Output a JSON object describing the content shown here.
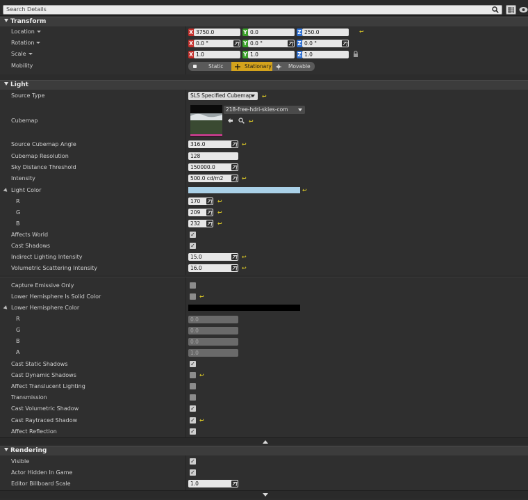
{
  "search": {
    "placeholder": "Search Details"
  },
  "transform": {
    "header": "Transform",
    "location": {
      "label": "Location",
      "x": "3750.0",
      "y": "0.0",
      "z": "250.0"
    },
    "rotation": {
      "label": "Rotation",
      "x": "0.0 °",
      "y": "0.0 °",
      "z": "0.0 °"
    },
    "scale": {
      "label": "Scale",
      "x": "1.0",
      "y": "1.0",
      "z": "1.0"
    },
    "axes": {
      "x": "X",
      "y": "Y",
      "z": "Z"
    },
    "mobility": {
      "label": "Mobility",
      "options": [
        "Static",
        "Stationary",
        "Movable"
      ],
      "selected": "Stationary"
    }
  },
  "light": {
    "header": "Light",
    "source_type": {
      "label": "Source Type",
      "value": "SLS Specified Cubemap"
    },
    "cubemap": {
      "label": "Cubemap",
      "asset": "218-free-hdri-skies-com"
    },
    "source_cubemap_angle": {
      "label": "Source Cubemap Angle",
      "value": "316.0"
    },
    "cubemap_resolution": {
      "label": "Cubemap Resolution",
      "value": "128"
    },
    "sky_distance_threshold": {
      "label": "Sky Distance Threshold",
      "value": "150000.0"
    },
    "intensity": {
      "label": "Intensity",
      "value": "500.0 cd/m2"
    },
    "light_color": {
      "label": "Light Color",
      "swatch": "#aad1e8",
      "r_label": "R",
      "g_label": "G",
      "b_label": "B",
      "r": "170",
      "g": "209",
      "b": "232"
    },
    "affects_world": {
      "label": "Affects World"
    },
    "cast_shadows": {
      "label": "Cast Shadows"
    },
    "indirect_lighting_intensity": {
      "label": "Indirect Lighting Intensity",
      "value": "15.0"
    },
    "volumetric_scattering_intensity": {
      "label": "Volumetric Scattering Intensity",
      "value": "16.0"
    },
    "capture_emissive_only": {
      "label": "Capture Emissive Only"
    },
    "lower_hemisphere_is_solid_color": {
      "label": "Lower Hemisphere Is Solid Color"
    },
    "lower_hemisphere_color": {
      "label": "Lower Hemisphere Color",
      "swatch": "#000000",
      "r_label": "R",
      "g_label": "G",
      "b_label": "B",
      "a_label": "A",
      "r": "0.0",
      "g": "0.0",
      "b": "0.0",
      "a": "1.0"
    },
    "cast_static_shadows": {
      "label": "Cast Static Shadows"
    },
    "cast_dynamic_shadows": {
      "label": "Cast Dynamic Shadows"
    },
    "affect_translucent_lighting": {
      "label": "Affect Translucent Lighting"
    },
    "transmission": {
      "label": "Transmission"
    },
    "cast_volumetric_shadow": {
      "label": "Cast Volumetric Shadow"
    },
    "cast_raytraced_shadow": {
      "label": "Cast Raytraced Shadow"
    },
    "affect_reflection": {
      "label": "Affect Reflection"
    }
  },
  "rendering": {
    "header": "Rendering",
    "visible": {
      "label": "Visible"
    },
    "actor_hidden_in_game": {
      "label": "Actor Hidden In Game"
    },
    "editor_billboard_scale": {
      "label": "Editor Billboard Scale",
      "value": "1.0"
    }
  },
  "glyphs": {
    "check": "✓",
    "reset": "↩"
  }
}
